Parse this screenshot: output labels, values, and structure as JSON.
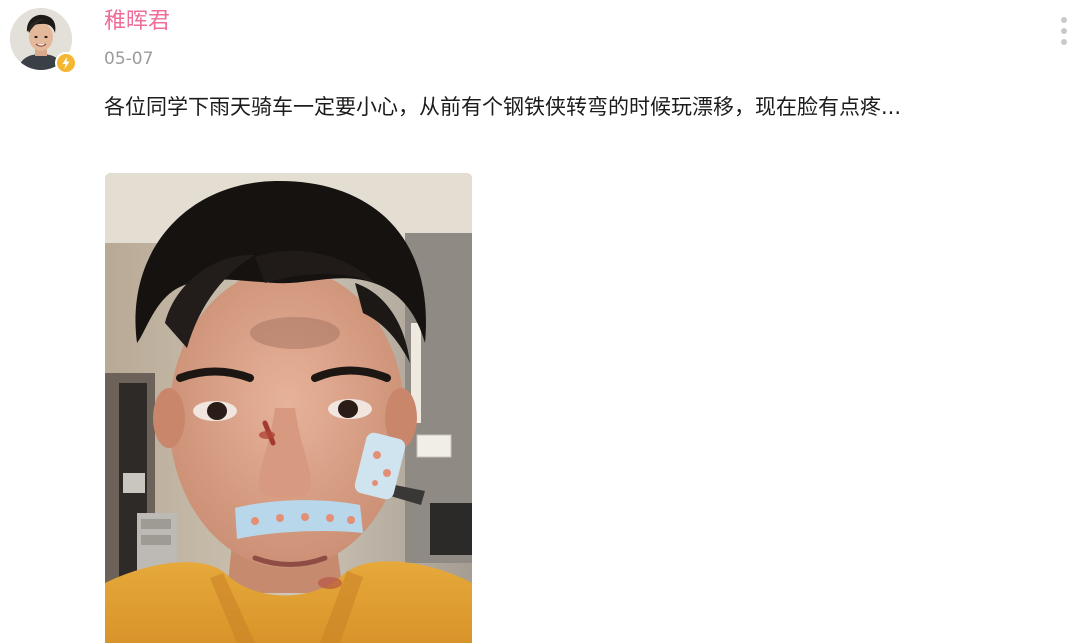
{
  "post": {
    "author": {
      "name": "稚晖君",
      "avatar_icon": "avatar-photo",
      "badge_icon": "lightning-icon",
      "badge_color": "#f5b731"
    },
    "date": "05-07",
    "text": "各位同学下雨天骑车一定要小心，从前有个钢铁侠转弯的时候玩漂移，现在脸有点疼...",
    "more_icon": "more-vertical-icon",
    "image": {
      "type": "photo",
      "subject": "selfie-with-bandages"
    }
  },
  "colors": {
    "username": "#ef6d97",
    "date": "#9b9b9b",
    "text": "#1c1c1c",
    "more_dots": "#c9c9c9"
  }
}
